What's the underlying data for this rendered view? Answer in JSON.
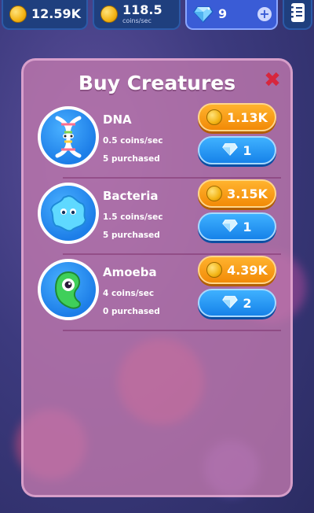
{
  "topbar": {
    "coins": "12.59K",
    "rate_value": "118.5",
    "rate_unit": "coins/sec",
    "gems": "9"
  },
  "modal": {
    "title": "Buy Creatures",
    "close_symbol": "✖"
  },
  "creatures": [
    {
      "name": "DNA",
      "rate": "0.5 coins/sec",
      "owned": "5 purchased",
      "coin_price": "1.13K",
      "gem_price": "1",
      "icon": "dna-icon"
    },
    {
      "name": "Bacteria",
      "rate": "1.5 coins/sec",
      "owned": "5 purchased",
      "coin_price": "3.15K",
      "gem_price": "1",
      "icon": "bacteria-icon"
    },
    {
      "name": "Amoeba",
      "rate": "4 coins/sec",
      "owned": "0 purchased",
      "coin_price": "4.39K",
      "gem_price": "2",
      "icon": "amoeba-icon"
    }
  ],
  "colors": {
    "modal_bg": "#c47aae",
    "coin_button": "#f28a07",
    "gem_button": "#1682e9",
    "avatar_bg": "#1d7ee8",
    "close": "#d7263d"
  }
}
